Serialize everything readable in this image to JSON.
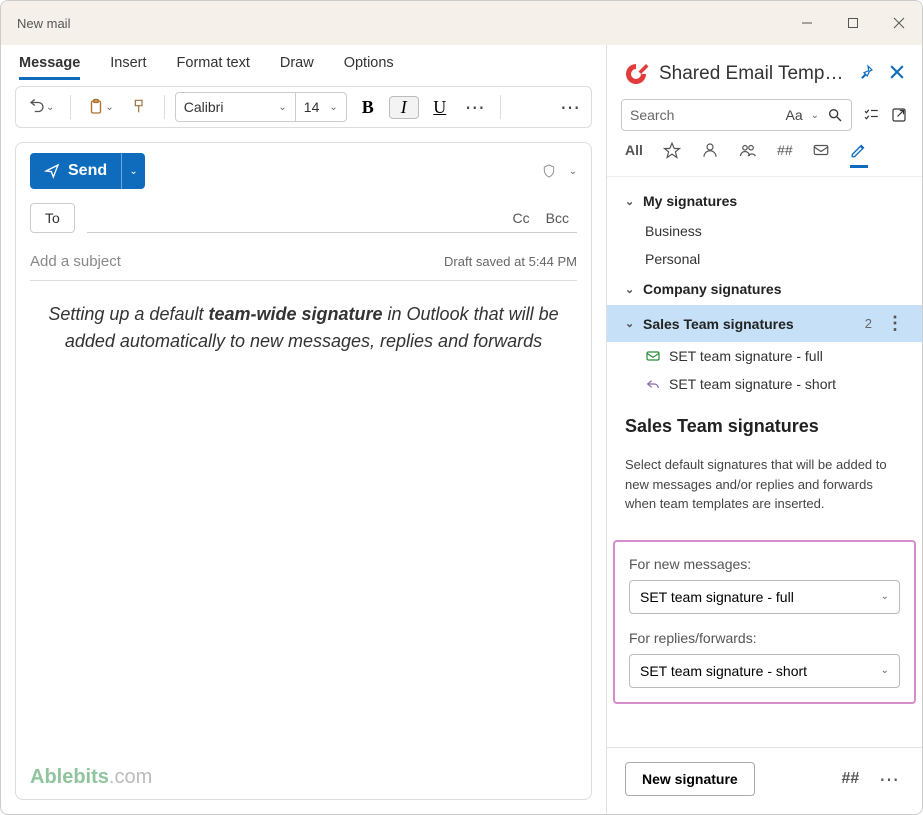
{
  "window": {
    "title": "New mail"
  },
  "tabs": [
    "Message",
    "Insert",
    "Format text",
    "Draw",
    "Options"
  ],
  "toolbar": {
    "font_name": "Calibri",
    "font_size": "14"
  },
  "compose": {
    "send": "Send",
    "to_button": "To",
    "cc": "Cc",
    "bcc": "Bcc",
    "subject_placeholder": "Add a subject",
    "draft_status": "Draft saved at 5:44 PM",
    "body_pre": "Setting up a default ",
    "body_strong": "team-wide signature",
    "body_post": " in Outlook that will be added automatically to new messages, replies and forwards"
  },
  "watermark": {
    "brand": "Ablebits",
    "tld": ".com"
  },
  "panel": {
    "title": "Shared Email Temp…",
    "search_placeholder": "Search",
    "aa": "Aa",
    "all": "All",
    "hash": "##",
    "groups": {
      "my": "My signatures",
      "company": "Company signatures",
      "sales": "Sales Team signatures"
    },
    "items": {
      "business": "Business",
      "personal": "Personal",
      "full": "SET team signature - full",
      "short": "SET team signature - short"
    },
    "sales_count": "2",
    "details_title": "Sales Team signatures",
    "details_desc": "Select default signatures that will be added to new messages and/or replies and forwards when team templates are inserted.",
    "for_new": "For new messages:",
    "for_replies": "For replies/forwards:",
    "sel_new": "SET team signature - full",
    "sel_reply": "SET team signature - short",
    "new_sig": "New signature",
    "foot_hash": "##"
  }
}
